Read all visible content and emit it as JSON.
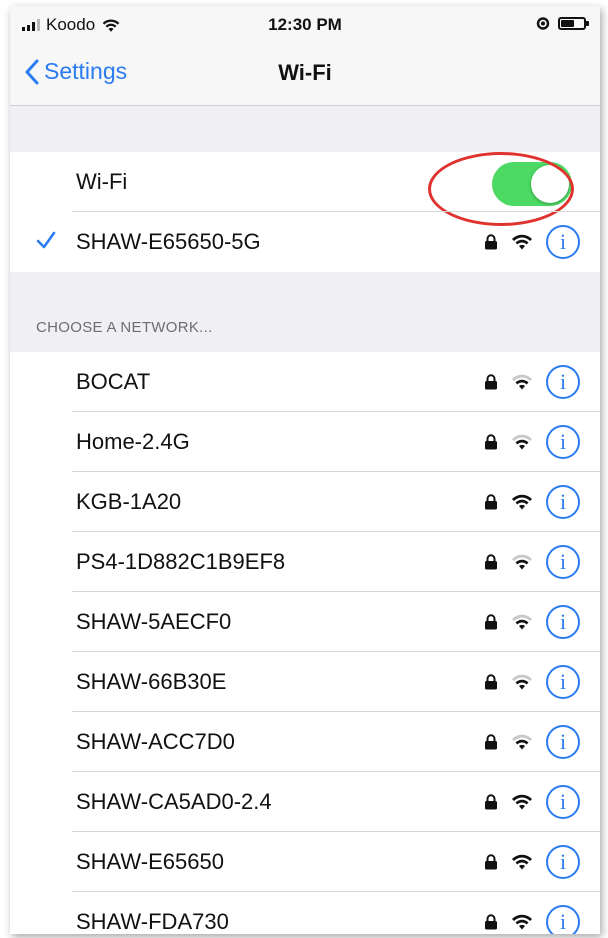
{
  "status_bar": {
    "carrier": "Koodo",
    "time": "12:30 PM",
    "battery_level": 0.6
  },
  "nav": {
    "back_label": "Settings",
    "title": "Wi-Fi"
  },
  "wifi_toggle": {
    "label": "Wi-Fi",
    "on": true
  },
  "connected_network": {
    "name": "SHAW-E65650-5G",
    "secured": true,
    "signal": 3
  },
  "section_header": "CHOOSE A NETWORK...",
  "networks": [
    {
      "name": "BOCAT",
      "secured": true,
      "signal": 2
    },
    {
      "name": "Home-2.4G",
      "secured": true,
      "signal": 2
    },
    {
      "name": "KGB-1A20",
      "secured": true,
      "signal": 3
    },
    {
      "name": "PS4-1D882C1B9EF8",
      "secured": true,
      "signal": 2
    },
    {
      "name": "SHAW-5AECF0",
      "secured": true,
      "signal": 2
    },
    {
      "name": "SHAW-66B30E",
      "secured": true,
      "signal": 2
    },
    {
      "name": "SHAW-ACC7D0",
      "secured": true,
      "signal": 2
    },
    {
      "name": "SHAW-CA5AD0-2.4",
      "secured": true,
      "signal": 3
    },
    {
      "name": "SHAW-E65650",
      "secured": true,
      "signal": 3
    },
    {
      "name": "SHAW-FDA730",
      "secured": true,
      "signal": 3
    }
  ],
  "colors": {
    "accent": "#2a7cf2",
    "toggle_on": "#4cd964",
    "highlight": "#e0332f"
  },
  "icons": {
    "back": "chevron-left-icon",
    "check": "checkmark-icon",
    "lock": "lock-icon",
    "wifi": "wifi-signal-icon",
    "info": "info-icon"
  }
}
